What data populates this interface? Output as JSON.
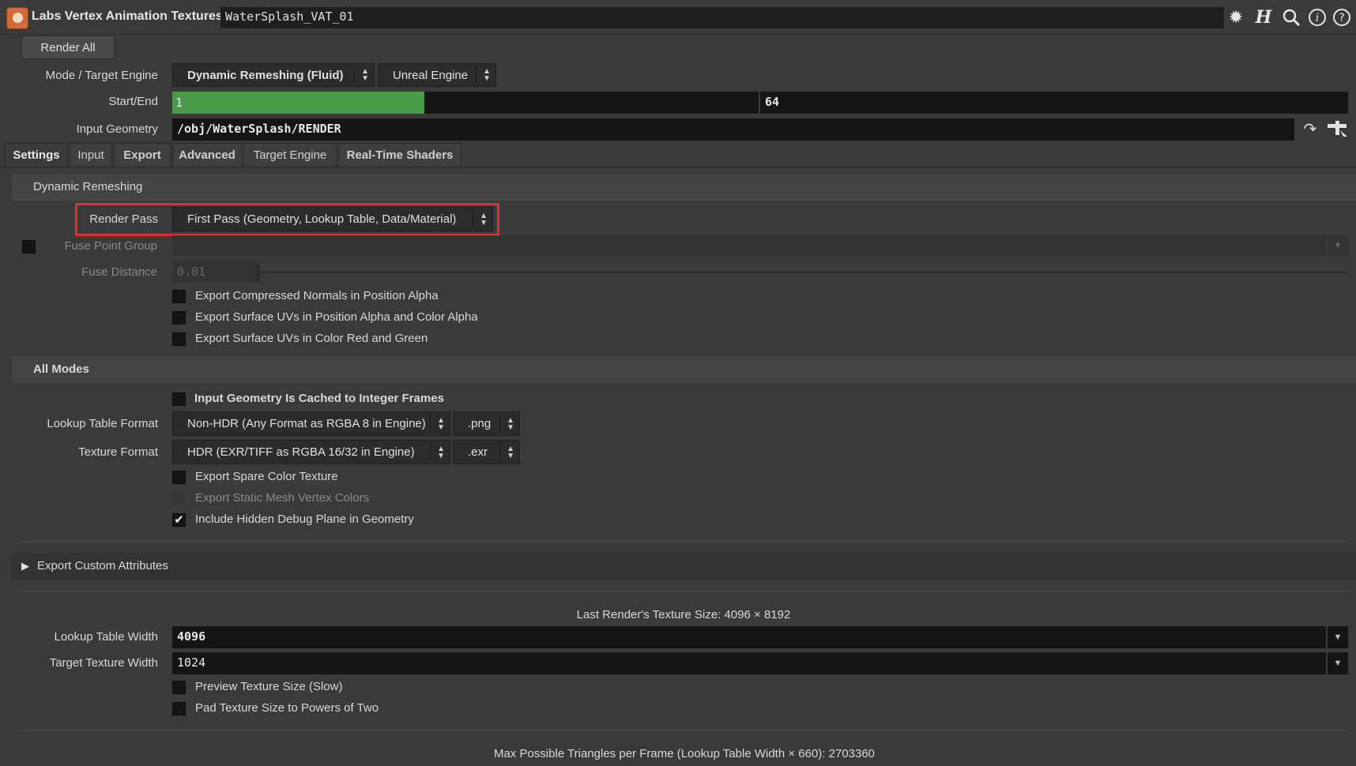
{
  "header": {
    "node_type": "Labs Vertex Animation Textures",
    "node_name": "WaterSplash_VAT_01",
    "icons": [
      "gear-icon",
      "houdini-help-icon",
      "search-icon",
      "info-icon",
      "help-icon"
    ]
  },
  "render_all_label": "Render All",
  "mode": {
    "label": "Mode / Target Engine",
    "mode_value": "Dynamic Remeshing (Fluid)",
    "engine_value": "Unreal Engine"
  },
  "start_end": {
    "label": "Start/End",
    "start": "1",
    "end": "64",
    "slider_fraction": 0.43
  },
  "input_geometry": {
    "label": "Input Geometry",
    "value": "/obj/WaterSplash/RENDER"
  },
  "tabs": [
    {
      "label": "Settings",
      "active": true
    },
    {
      "label": "Input",
      "active": false
    },
    {
      "label": "Export",
      "active": false
    },
    {
      "label": "Advanced",
      "active": false
    },
    {
      "label": "Target Engine",
      "active": false
    },
    {
      "label": "Real-Time Shaders",
      "active": false
    }
  ],
  "dynamic_remeshing": {
    "title": "Dynamic Remeshing",
    "render_pass_label": "Render Pass",
    "render_pass_value": "First Pass (Geometry, Lookup Table, Data/Material)",
    "fuse_point_group_label": "Fuse Point Group",
    "fuse_distance_label": "Fuse Distance",
    "fuse_distance_value": "0.01",
    "checks": [
      {
        "label": "Export Compressed Normals in Position Alpha",
        "checked": false
      },
      {
        "label": "Export Surface UVs in Position Alpha and Color Alpha",
        "checked": false
      },
      {
        "label": "Export Surface UVs in Color Red and Green",
        "checked": false
      }
    ]
  },
  "all_modes": {
    "title": "All Modes",
    "cached_label": "Input Geometry Is Cached to Integer Frames",
    "lookup_format_label": "Lookup Table Format",
    "lookup_format_value": "Non-HDR (Any Format as RGBA 8 in Engine)",
    "lookup_ext": ".png",
    "texture_format_label": "Texture Format",
    "texture_format_value": "HDR (EXR/TIFF as RGBA 16/32 in Engine)",
    "texture_ext": ".exr",
    "spare_color_label": "Export Spare Color Texture",
    "static_mesh_label": "Export Static Mesh Vertex Colors",
    "debug_plane_label": "Include Hidden Debug Plane in Geometry",
    "debug_plane_checked": true
  },
  "custom_attrs_label": "Export Custom Attributes",
  "texture_size_info": "Last Render's Texture Size: 4096 × 8192",
  "lookup_width": {
    "label": "Lookup Table Width",
    "value": "4096"
  },
  "target_width": {
    "label": "Target Texture Width",
    "value": "1024"
  },
  "preview_size_label": "Preview Texture Size (Slow)",
  "pad_size_label": "Pad Texture Size to Powers of Two",
  "max_triangles_info": "Max Possible Triangles per Frame (Lookup Table Width × 660): 2703360",
  "colors": {
    "slider_fill": "#4a9a4a",
    "highlight_box": "#e03030"
  }
}
